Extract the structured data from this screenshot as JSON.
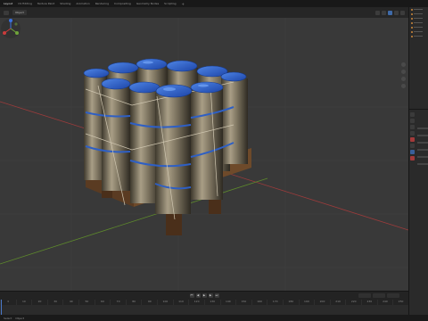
{
  "workspace_tabs": [
    "Layout",
    "UV Editing",
    "Texture Paint",
    "Shading",
    "Animation",
    "Rendering",
    "Compositing",
    "Geometry Nodes",
    "Scripting"
  ],
  "viewport_header": {
    "mode": "Object"
  },
  "timeline": {
    "ruler": [
      "0",
      "10",
      "20",
      "30",
      "40",
      "50",
      "60",
      "70",
      "80",
      "90",
      "100",
      "110",
      "120",
      "130",
      "140",
      "150",
      "160",
      "170",
      "180",
      "190",
      "200",
      "210",
      "220",
      "230",
      "240",
      "250"
    ]
  },
  "status_bar": {
    "left": "Select",
    "right": "Object"
  },
  "icons": {
    "gizmo": "navigation-gizmo-icon",
    "play": "play-icon"
  },
  "colors": {
    "viewport_bg": "#393939",
    "lid_blue": "#2d5fc8",
    "axis_red": "#9c3b3b",
    "axis_green": "#5e8a2c"
  }
}
